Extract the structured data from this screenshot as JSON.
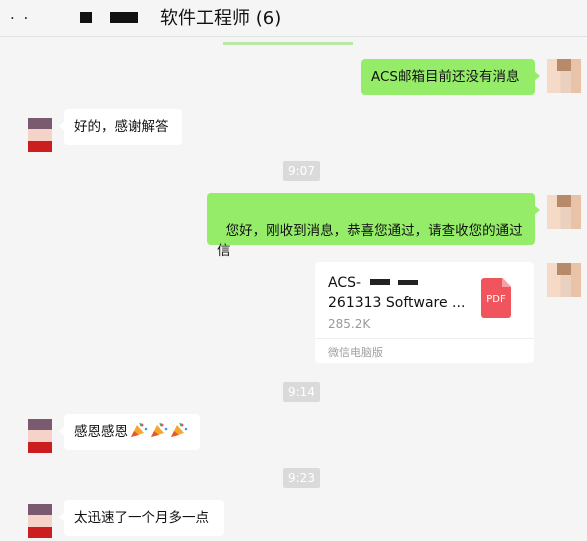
{
  "header": {
    "title_prefix": ". .",
    "title": "软件工程师 (6)"
  },
  "messages": [
    {
      "side": "right",
      "type": "text",
      "text": "ACS邮箱目前还没有消息"
    },
    {
      "side": "left",
      "type": "text",
      "text": "好的，感谢解答"
    },
    {
      "type": "time",
      "text": "9:07"
    },
    {
      "side": "right",
      "type": "text",
      "text": "您好，刚收到消息，恭喜您通过，请查收您的通过\n信"
    },
    {
      "side": "right",
      "type": "file",
      "file_name": "ACS-\n261313 Software ...",
      "file_size": "285.2K",
      "file_type": "PDF",
      "source": "微信电脑版"
    },
    {
      "type": "time",
      "text": "9:14"
    },
    {
      "side": "left",
      "type": "text",
      "text": "感恩感恩",
      "emoji": [
        "party-popper-icon",
        "party-popper-icon",
        "party-popper-icon"
      ]
    },
    {
      "type": "time",
      "text": "9:23"
    },
    {
      "side": "left",
      "type": "text",
      "text": "太迅速了一个月多一点"
    }
  ],
  "colors": {
    "sent_bubble": "#95ec69",
    "received_bubble": "#ffffff",
    "background": "#f5f5f5",
    "timestamp_bg": "#dadada",
    "pdf_icon": "#f0555d"
  }
}
